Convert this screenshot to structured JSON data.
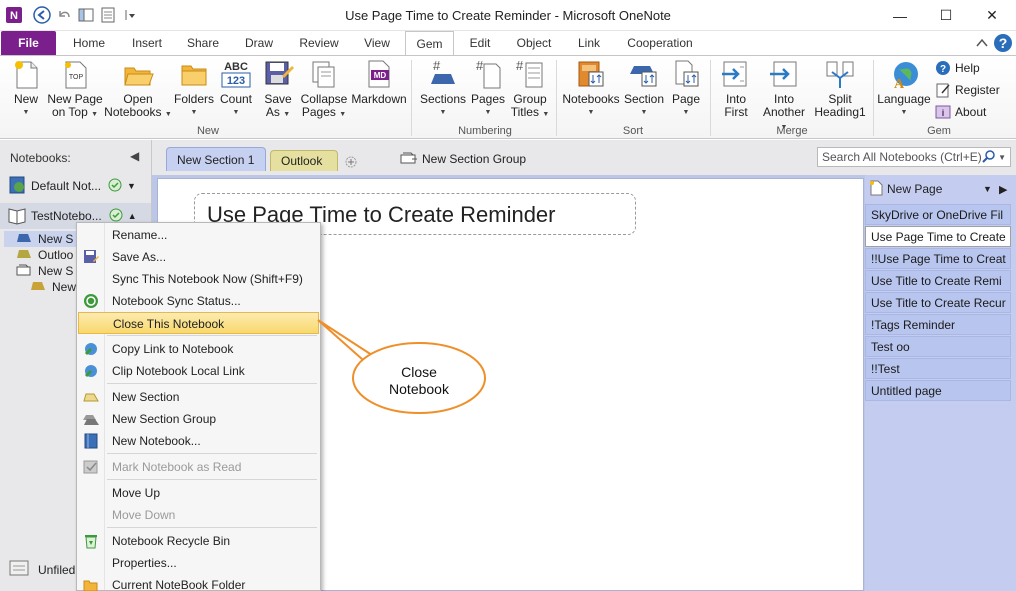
{
  "window": {
    "title": "Use Page Time to Create Reminder  -  Microsoft OneNote",
    "minimize_glyph": "—",
    "maximize_glyph": "☐",
    "close_glyph": "✕"
  },
  "ribbon_tabs": {
    "file": "File",
    "tabs": [
      "Home",
      "Insert",
      "Share",
      "Draw",
      "Review",
      "View",
      "Gem",
      "Edit",
      "Object",
      "Link",
      "Cooperation"
    ],
    "active": "Gem"
  },
  "ribbon": {
    "new": [
      "New",
      ""
    ],
    "new_page_on_top": [
      "New Page",
      "on Top"
    ],
    "open_notebooks": [
      "Open",
      "Notebooks"
    ],
    "folders": [
      "Folders",
      ""
    ],
    "count": [
      "Count",
      ""
    ],
    "save_as": [
      "Save",
      "As"
    ],
    "collapse_pages": [
      "Collapse",
      "Pages"
    ],
    "markdown": [
      "Markdown",
      ""
    ],
    "sections": [
      "Sections",
      ""
    ],
    "pages": [
      "Pages",
      ""
    ],
    "group_titles": [
      "Group",
      "Titles"
    ],
    "notebooks": [
      "Notebooks",
      ""
    ],
    "section": [
      "Section",
      ""
    ],
    "page": [
      "Page",
      ""
    ],
    "into_first": [
      "Into",
      "First"
    ],
    "into_another": [
      "Into",
      "Another"
    ],
    "split_heading": [
      "Split",
      "Heading1"
    ],
    "language": [
      "Language",
      ""
    ],
    "help": "Help",
    "register": "Register",
    "about": "About",
    "count_icon_text": "ABC\n123",
    "markdown_icon_text": "MD",
    "top_icon_text": "TOP",
    "groups": [
      "New",
      "Numbering",
      "Sort",
      "Merge",
      "Gem"
    ]
  },
  "notebooks_pane": {
    "header": "Notebooks:",
    "notebooks": [
      "Default Not...",
      "TestNotebo..."
    ],
    "sections": [
      "New S",
      "Outloo",
      "New S",
      "New"
    ],
    "unfiled": "Unfiled"
  },
  "section_tabs": {
    "tabs": [
      "New Section 1",
      "Outlook"
    ],
    "new_section_group": "New Section Group",
    "search_placeholder": "Search All Notebooks (Ctrl+E)"
  },
  "page": {
    "title": "Use Page Time to Create Reminder"
  },
  "pages_list": {
    "new_page": "New Page",
    "items": [
      "SkyDrive or OneDrive Fil",
      "Use Page Time to Create",
      "!!Use Page Time to Creat",
      "Use Title to Create Remi",
      "Use Title to Create Recur",
      "!Tags Reminder",
      "Test oo",
      "!!Test",
      "Untitled page"
    ],
    "selected_index": 1
  },
  "context_menu": {
    "items": [
      "Rename...",
      "Save As...",
      "Sync This Notebook Now  (Shift+F9)",
      "Notebook Sync Status...",
      "Close This Notebook",
      "Copy Link to Notebook",
      "Clip Notebook Local Link",
      "New Section",
      "New Section Group",
      "New Notebook...",
      "Mark Notebook as Read",
      "Move Up",
      "Move Down",
      "Notebook Recycle Bin",
      "Properties...",
      "Current NoteBook Folder"
    ]
  },
  "callout": {
    "line1": "Close",
    "line2": "Notebook"
  },
  "colors": {
    "file_tab": "#7b1f8c",
    "highlight": "#f8d96c",
    "callout_border": "#ef8f2a",
    "page_list_bg": "#c4cdf0"
  }
}
